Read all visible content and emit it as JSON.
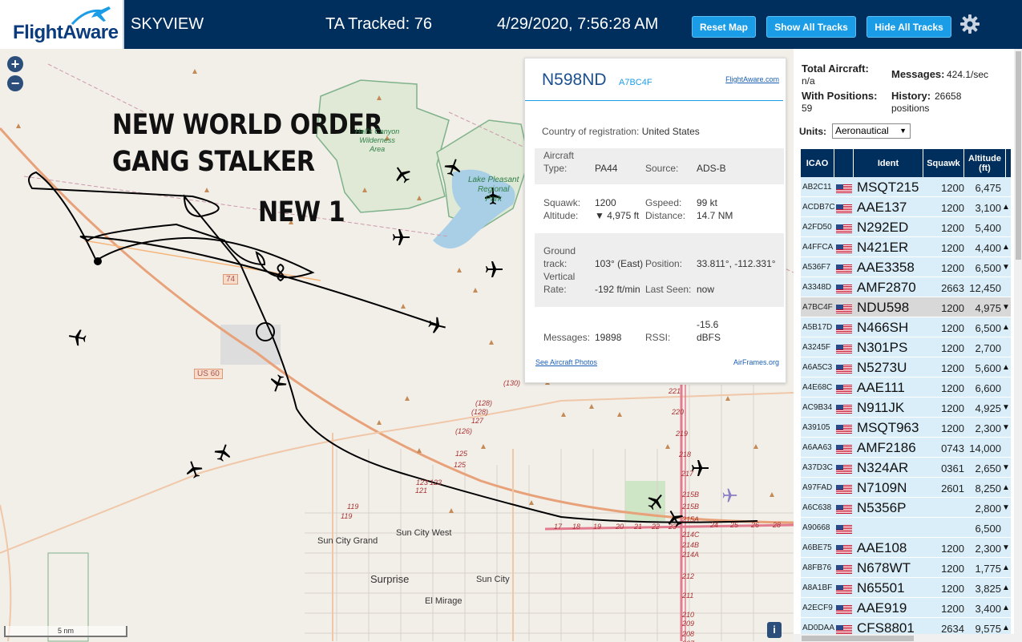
{
  "header": {
    "logo_text": "FlightAware",
    "app_title": "SKYVIEW",
    "tracked": "TA Tracked: 76",
    "datetime": "4/29/2020, 7:56:28 AM",
    "buttons": {
      "reset": "Reset Map",
      "show_all": "Show All Tracks",
      "hide_all": "Hide All Tracks"
    }
  },
  "map": {
    "overlay": [
      "NEW WORLD ORDER",
      "GANG STALKER",
      "NEW 1"
    ],
    "place_labels": {
      "wilderness": [
        "Hell's Canyon",
        "Wilderness",
        "Area"
      ],
      "lake": [
        "Lake Pleasant",
        "Regional",
        "Park"
      ],
      "sun_city_west": "Sun City West",
      "sun_city_grand": "Sun City Grand",
      "surprise": "Surprise",
      "sun_city": "Sun City",
      "el_mirage": "El Mirage",
      "us60": "US 60",
      "shield74": "74"
    },
    "road_numbers": [
      "(130)",
      "(128)",
      "(128)",
      "127",
      "(126)",
      "125",
      "125",
      "123",
      "123",
      "121",
      "119",
      "119",
      "17",
      "18",
      "19",
      "20",
      "21",
      "22",
      "23",
      "24",
      "25",
      "26",
      "28",
      "221",
      "220",
      "219",
      "218",
      "217",
      "215B",
      "215B",
      "215A",
      "214C",
      "214B",
      "214A",
      "212",
      "211",
      "210",
      "209",
      "208",
      "207"
    ],
    "zoom_in": "+",
    "zoom_out": "−",
    "scale": "5 nm",
    "info": "i"
  },
  "card": {
    "registration": "N598ND",
    "hex": "A7BC4F",
    "fa_link": "FlightAware.com",
    "country_label": "Country of registration:",
    "country": "United States",
    "type_label": "Aircraft Type:",
    "type_label_1": "Aircraft",
    "type_label_2": "Type:",
    "type": "PA44",
    "source_label": "Source:",
    "source": "ADS-B",
    "squawk_label": "Squawk:",
    "squawk": "1200",
    "gspeed_label": "Gspeed:",
    "gspeed": "99 kt",
    "altitude_label": "Altitude:",
    "altitude": "▼ 4,975 ft",
    "distance_label": "Distance:",
    "distance": "14.7 NM",
    "track_label_1": "Ground",
    "track_label_2": "track:",
    "track": "103° (East)",
    "position_label": "Position:",
    "position": "33.811°, -112.331°",
    "vrate_label_1": "Vertical",
    "vrate_label_2": "Rate:",
    "vrate": "-192 ft/min",
    "lastseen_label": "Last Seen:",
    "lastseen": "now",
    "messages_label": "Messages:",
    "messages": "19898",
    "rssi_label": "RSSI:",
    "rssi_1": "-15.6",
    "rssi_2": "dBFS",
    "photos_link": "See Aircraft Photos",
    "airframes_link": "AirFrames.org"
  },
  "sidebar": {
    "total_aircraft_label": "Total Aircraft:",
    "total_aircraft": "n/a",
    "messages_label": "Messages:",
    "messages": "424.1/sec",
    "with_positions_label": "With Positions:",
    "with_positions": "59",
    "history_label": "History:",
    "history": "26658",
    "history_unit": "positions",
    "units_label": "Units:",
    "units_value": "Aeronautical",
    "columns": [
      "ICAO",
      "Ident",
      "Squawk",
      "Altitude (ft)"
    ],
    "rows": [
      {
        "icao": "AB2C11",
        "ident": "MSQT215",
        "squawk": "1200",
        "alt": "6,475",
        "trend": ""
      },
      {
        "icao": "ACDB7C",
        "ident": "AAE137",
        "squawk": "1200",
        "alt": "3,100",
        "trend": "▲"
      },
      {
        "icao": "A2FD50",
        "ident": "N292ED",
        "squawk": "1200",
        "alt": "5,400",
        "trend": ""
      },
      {
        "icao": "A4FFCA",
        "ident": "N421ER",
        "squawk": "1200",
        "alt": "4,400",
        "trend": "▲"
      },
      {
        "icao": "A536F7",
        "ident": "AAE3358",
        "squawk": "1200",
        "alt": "6,500",
        "trend": "▼"
      },
      {
        "icao": "A3348D",
        "ident": "AMF2870",
        "squawk": "2663",
        "alt": "12,450",
        "trend": ""
      },
      {
        "icao": "A7BC4F",
        "ident": "NDU598",
        "squawk": "1200",
        "alt": "4,975",
        "trend": "▼"
      },
      {
        "icao": "A5B17D",
        "ident": "N466SH",
        "squawk": "1200",
        "alt": "6,500",
        "trend": "▲"
      },
      {
        "icao": "A3245F",
        "ident": "N301PS",
        "squawk": "1200",
        "alt": "2,700",
        "trend": ""
      },
      {
        "icao": "A6A5C3",
        "ident": "N5273U",
        "squawk": "1200",
        "alt": "5,600",
        "trend": "▲"
      },
      {
        "icao": "A4E68C",
        "ident": "AAE111",
        "squawk": "1200",
        "alt": "6,600",
        "trend": ""
      },
      {
        "icao": "AC9B34",
        "ident": "N911JK",
        "squawk": "1200",
        "alt": "4,925",
        "trend": "▼"
      },
      {
        "icao": "A39105",
        "ident": "MSQT963",
        "squawk": "1200",
        "alt": "2,300",
        "trend": "▼"
      },
      {
        "icao": "A6AA63",
        "ident": "AMF2186",
        "squawk": "0743",
        "alt": "14,000",
        "trend": ""
      },
      {
        "icao": "A37D3C",
        "ident": "N324AR",
        "squawk": "0361",
        "alt": "2,650",
        "trend": "▼"
      },
      {
        "icao": "A97FAD",
        "ident": "N7109N",
        "squawk": "2601",
        "alt": "8,250",
        "trend": "▲"
      },
      {
        "icao": "A6C638",
        "ident": "N5356P",
        "squawk": "",
        "alt": "2,800",
        "trend": "▼"
      },
      {
        "icao": "A90668",
        "ident": "",
        "squawk": "",
        "alt": "6,500",
        "trend": ""
      },
      {
        "icao": "A6BE75",
        "ident": "AAE108",
        "squawk": "1200",
        "alt": "2,300",
        "trend": "▼"
      },
      {
        "icao": "A8FB76",
        "ident": "N678WT",
        "squawk": "1200",
        "alt": "1,775",
        "trend": "▲"
      },
      {
        "icao": "A8A1BF",
        "ident": "N65501",
        "squawk": "1200",
        "alt": "3,825",
        "trend": "▲"
      },
      {
        "icao": "A2ECF9",
        "ident": "AAE919",
        "squawk": "1200",
        "alt": "3,400",
        "trend": "▲"
      },
      {
        "icao": "AD0DAA",
        "ident": "CFS8801",
        "squawk": "2634",
        "alt": "9,575",
        "trend": "▲"
      }
    ],
    "selected_icao": "A7BC4F"
  },
  "colors": {
    "header_bg": "#002f5d",
    "button_bg": "#1a9de6",
    "row_bg": "#d9eef9",
    "row_selected_bg": "#d8d8d8",
    "accent": "#1b4f8e"
  }
}
